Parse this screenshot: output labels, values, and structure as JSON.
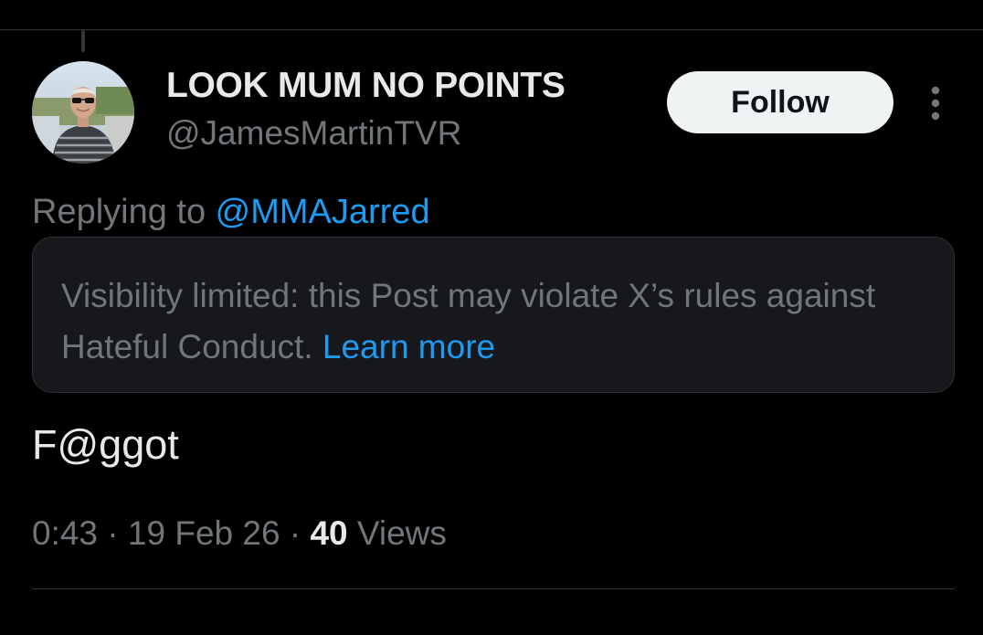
{
  "author": {
    "display_name": "LOOK MUM NO POINTS",
    "handle": "@JamesMartinTVR"
  },
  "actions": {
    "follow_label": "Follow",
    "more_icon": "more-vertical-icon"
  },
  "reply_context": {
    "prefix": "Replying to ",
    "mention": "@MMAJarred"
  },
  "notice": {
    "text": "Visibility limited: this Post may violate X’s rules against Hateful Conduct.",
    "link_label": "Learn more"
  },
  "post": {
    "text": "F@ggot"
  },
  "meta": {
    "time": "0:43",
    "date": "19 Feb 26",
    "separator": " · ",
    "views_count": "40",
    "views_label": " Views"
  },
  "colors": {
    "background": "#000000",
    "primary_text": "#e7e9ea",
    "secondary_text": "#71767b",
    "accent": "#1d9bf0",
    "notice_bg": "#16181c",
    "divider": "#2f3336"
  }
}
